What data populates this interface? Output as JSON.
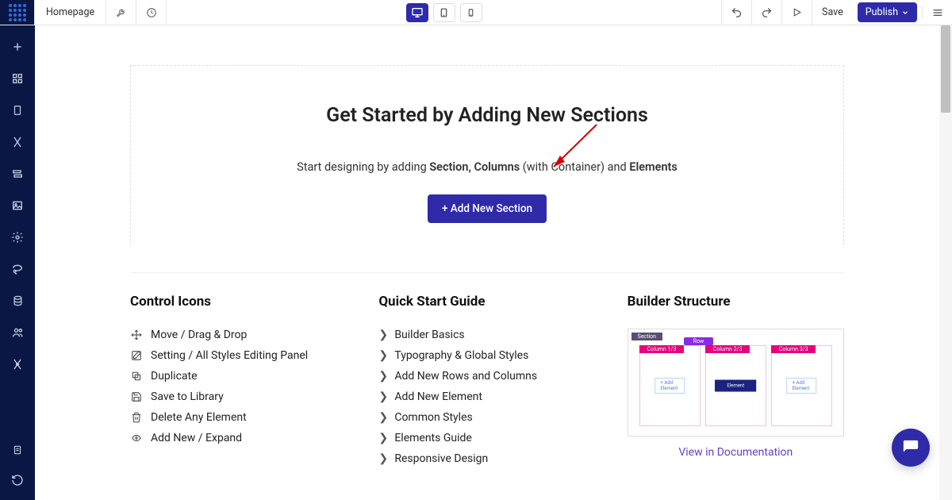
{
  "topbar": {
    "page_name": "Homepage",
    "save_label": "Save",
    "publish_label": "Publish"
  },
  "hero": {
    "title": "Get Started by Adding New Sections",
    "sub_prefix": "Start designing by adding ",
    "sub_strong1": "Section, Columns",
    "sub_mid": " (with Container) and ",
    "sub_strong2": "Elements",
    "button_label": "+ Add New Section"
  },
  "columns": {
    "control_icons": {
      "heading": "Control Icons",
      "items": [
        "Move / Drag & Drop",
        "Setting / All Styles Editing Panel",
        "Duplicate",
        "Save to Library",
        "Delete Any Element",
        "Add New / Expand"
      ]
    },
    "quick_start": {
      "heading": "Quick Start Guide",
      "items": [
        "Builder Basics",
        "Typography & Global Styles",
        "Add New Rows and Columns",
        "Add New Element",
        "Common Styles",
        "Elements Guide",
        "Responsive Design"
      ]
    },
    "structure": {
      "heading": "Builder Structure",
      "doc_link": "View in Documentation"
    }
  }
}
